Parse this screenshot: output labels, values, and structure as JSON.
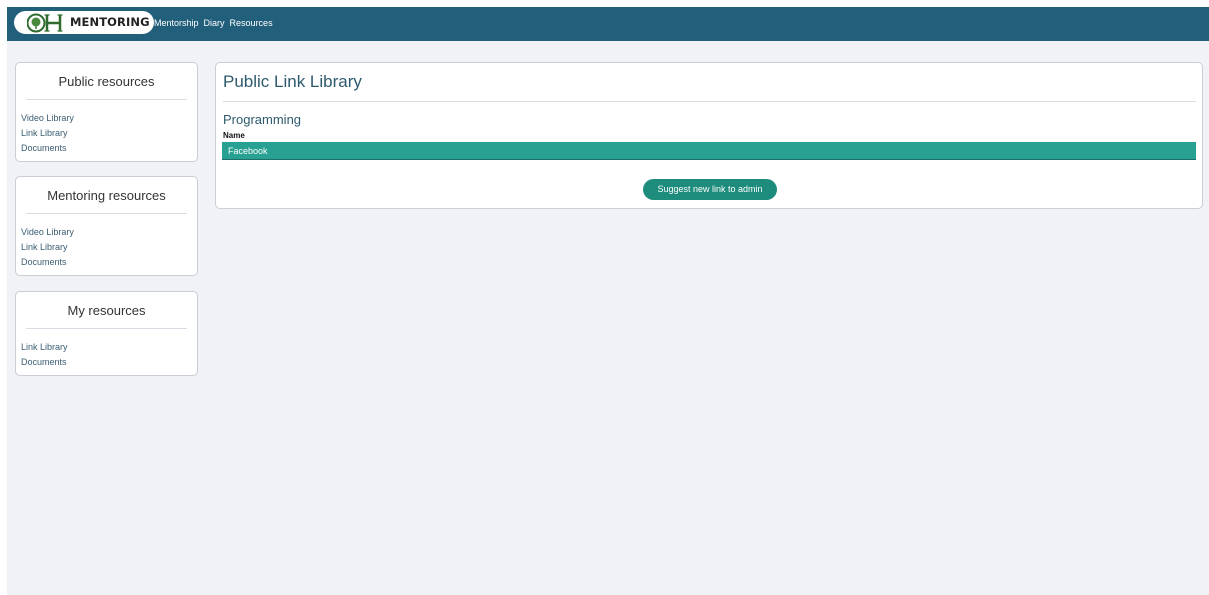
{
  "navbar": {
    "logo_text": "MENTORING",
    "links": [
      "Mentorship",
      "Diary",
      "Resources"
    ]
  },
  "sidebar": {
    "cards": [
      {
        "title": "Public resources",
        "links": [
          "Video Library",
          "Link Library",
          "Documents"
        ]
      },
      {
        "title": "Mentoring resources",
        "links": [
          "Video Library",
          "Link Library",
          "Documents"
        ]
      },
      {
        "title": "My resources",
        "links": [
          "Link Library",
          "Documents"
        ]
      }
    ]
  },
  "main": {
    "title": "Public Link Library",
    "section_title": "Programming",
    "column_header": "Name",
    "rows": [
      "Facebook"
    ],
    "suggest_button": "Suggest new link to admin"
  },
  "colors": {
    "navbar": "#215f7b",
    "page_bg": "#f1f2f6",
    "row_accent": "#28a092",
    "button": "#1e8c7c"
  }
}
